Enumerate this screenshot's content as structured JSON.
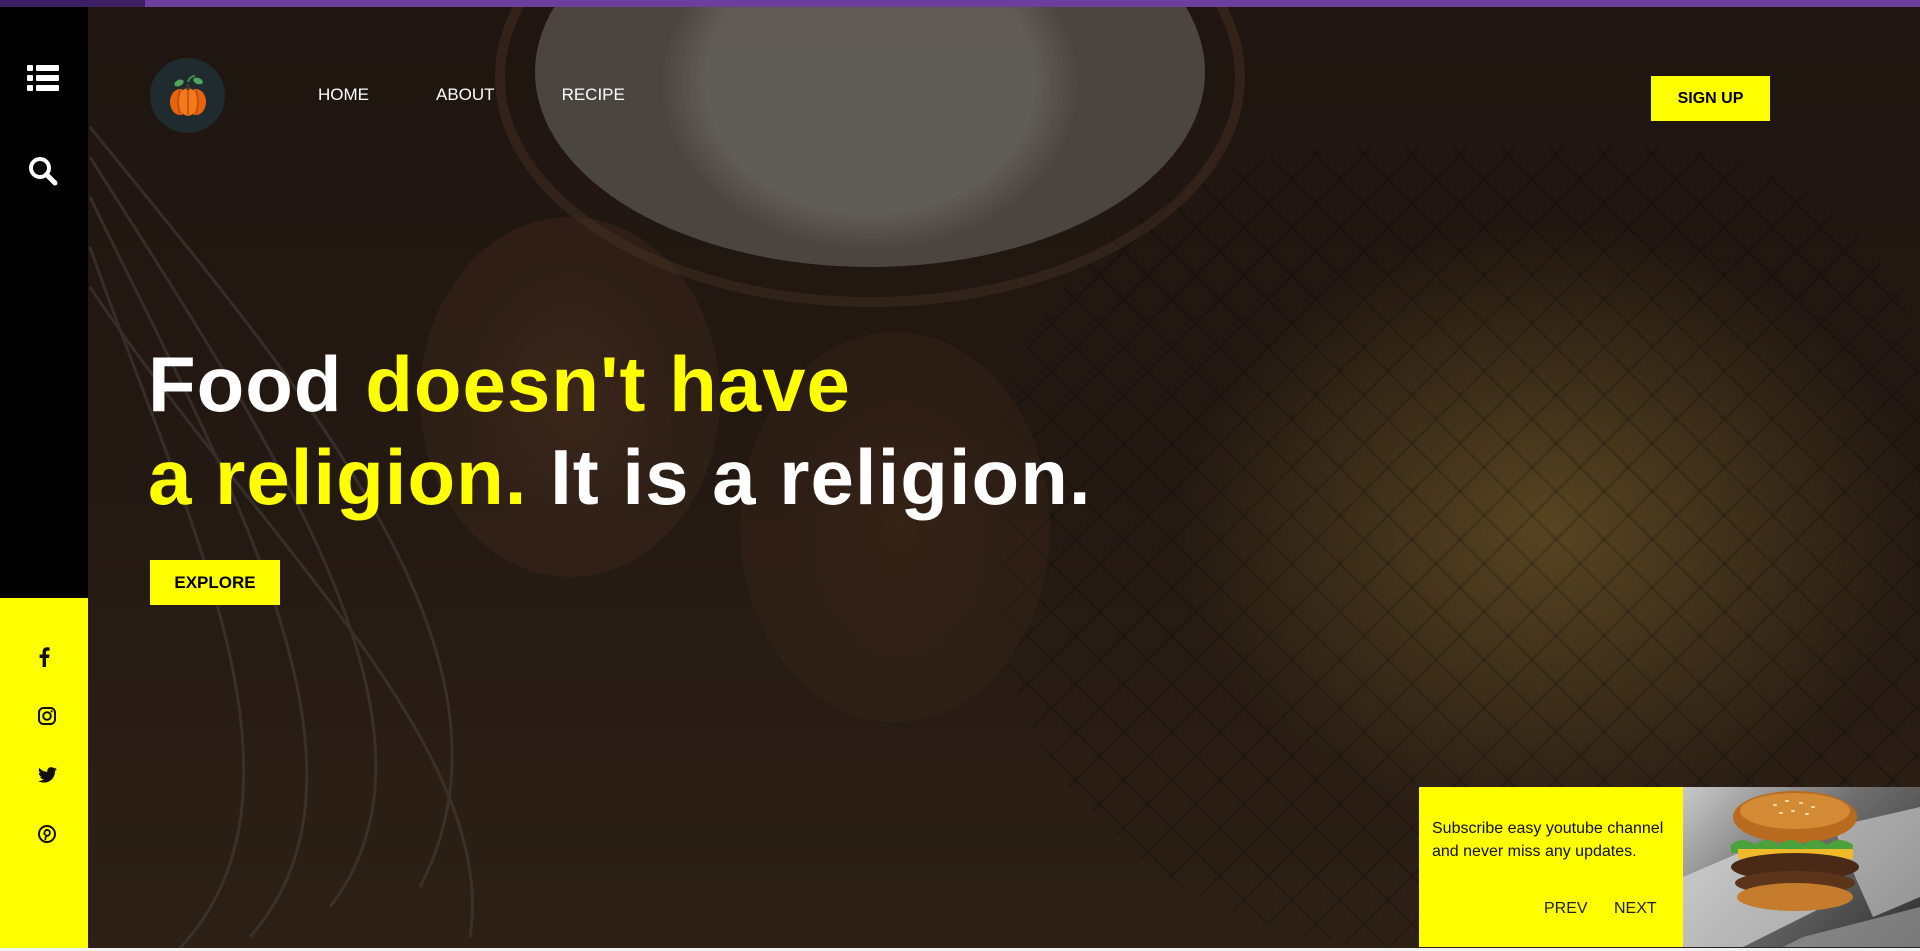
{
  "sidebar": {
    "top_icons": [
      "menu-list-icon",
      "search-icon"
    ],
    "social_icons": [
      "facebook-icon",
      "instagram-icon",
      "twitter-icon",
      "pinterest-icon"
    ]
  },
  "nav": {
    "items": [
      {
        "label": "HOME"
      },
      {
        "label": "ABOUT"
      },
      {
        "label": "RECIPE"
      }
    ],
    "signup_label": "SIGN UP"
  },
  "hero": {
    "line1_white": "Food ",
    "line1_yellow": "doesn't have",
    "line2_yellow": "a religion.",
    "line2_white": " It is a religion.",
    "explore_label": "EXPLORE"
  },
  "subscribe": {
    "text": "Subscribe easy youtube channel and never miss any updates.",
    "prev_label": "PREV",
    "next_label": "NEXT"
  },
  "colors": {
    "accent": "#ffff00",
    "sidebar": "#000000",
    "topbar": "#6c3f9f"
  }
}
